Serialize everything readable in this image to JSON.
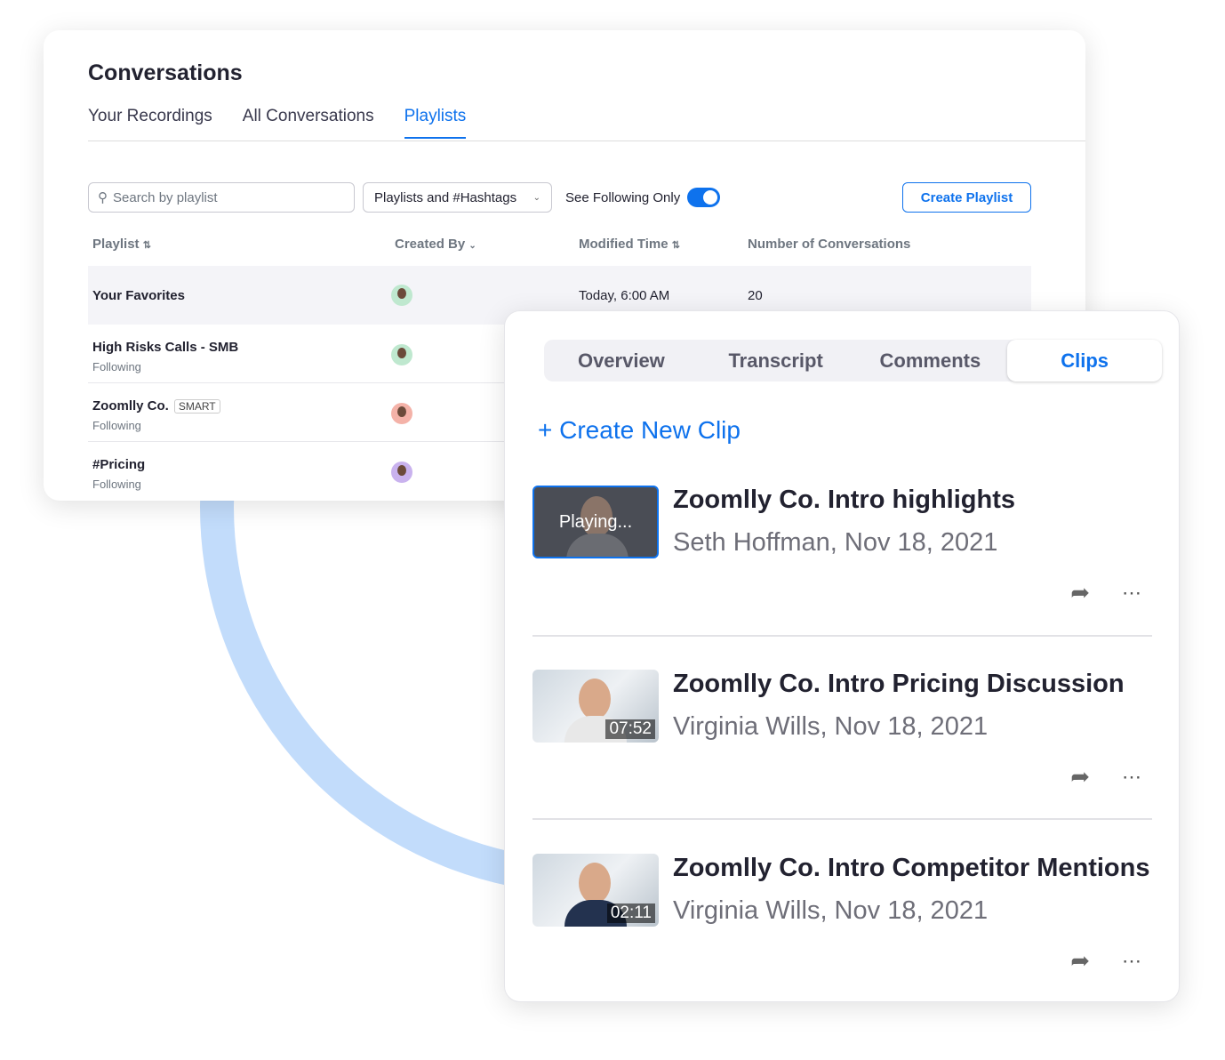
{
  "conversations": {
    "title": "Conversations",
    "tabs": [
      {
        "label": "Your Recordings"
      },
      {
        "label": "All Conversations"
      },
      {
        "label": "Playlists",
        "active": true
      }
    ],
    "search_placeholder": "Search by playlist",
    "filter_value": "Playlists and #Hashtags",
    "following_label": "See Following Only",
    "following_on": true,
    "create_label": "Create Playlist",
    "columns": [
      "Playlist",
      "Created By",
      "Modified Time",
      "Number of Conversations"
    ],
    "rows": [
      {
        "name": "Your Favorites",
        "sub": "",
        "badge": "",
        "modified": "Today, 6:00 AM",
        "count": "20",
        "avatar_color": "#bfe8cf"
      },
      {
        "name": "High Risks Calls - SMB",
        "sub": "Following",
        "badge": "",
        "modified": "",
        "count": "",
        "avatar_color": "#bfe8cf"
      },
      {
        "name": "Zoomlly Co.",
        "sub": "Following",
        "badge": "SMART",
        "modified": "",
        "count": "",
        "avatar_color": "#f4b2a8"
      },
      {
        "name": "#Pricing",
        "sub": "Following",
        "badge": "",
        "modified": "",
        "count": "",
        "avatar_color": "#c9b2ee"
      }
    ]
  },
  "clips_panel": {
    "tabs": [
      {
        "label": "Overview"
      },
      {
        "label": "Transcript"
      },
      {
        "label": "Comments"
      },
      {
        "label": "Clips",
        "active": true
      }
    ],
    "create_label": "+ Create New Clip",
    "clips": [
      {
        "title": "Zoomlly Co. Intro highlights",
        "meta": "Seth Hoffman, Nov 18, 2021",
        "overlay": "Playing..."
      },
      {
        "title": "Zoomlly Co. Intro Pricing Discussion",
        "meta": "Virginia Wills, Nov 18, 2021",
        "overlay": "07:52"
      },
      {
        "title": "Zoomlly Co. Intro Competitor Mentions",
        "meta": "Virginia Wills, Nov 18, 2021",
        "overlay": "02:11"
      }
    ]
  },
  "colors": {
    "accent": "#0e72ed",
    "arc": "#c2dcfb"
  }
}
